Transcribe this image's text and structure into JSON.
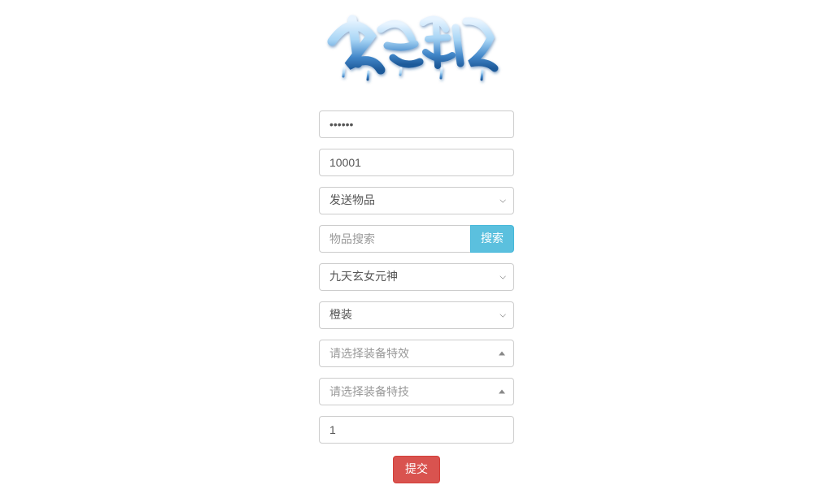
{
  "logo_alt": "大话许仙",
  "password_mask": "••••••",
  "player_id": "10001",
  "action_select": "发送物品",
  "item_search_placeholder": "物品搜索",
  "search_button": "搜索",
  "item_select": "九天玄女元神",
  "quality_select": "橙装",
  "equip_effect_placeholder": "请选择装备特效",
  "equip_skill_placeholder": "请选择装备特技",
  "quantity": "1",
  "submit_button": "提交",
  "colors": {
    "search_btn": "#5bc0de",
    "submit_btn": "#d9534f"
  }
}
